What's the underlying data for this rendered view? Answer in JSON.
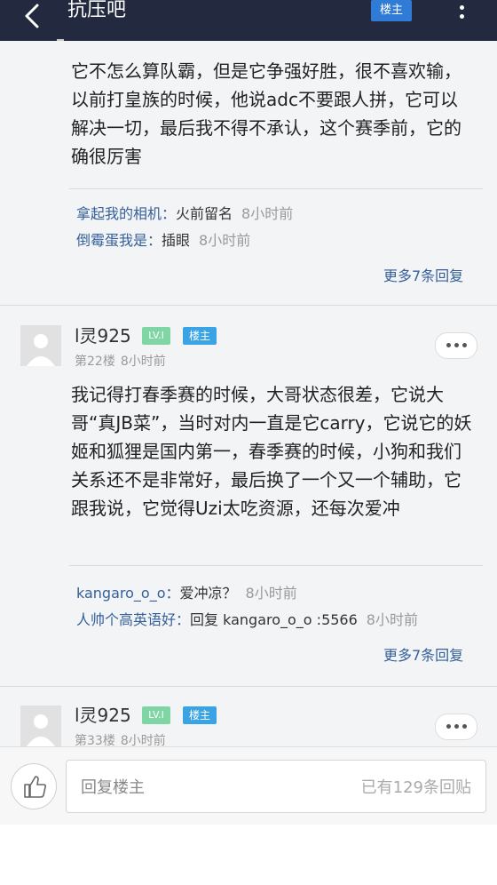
{
  "header": {
    "title": "抗压吧",
    "owner_only_label": "楼主"
  },
  "posts": [
    {
      "content": "它不怎么算队霸，但是它争强好胜，很不喜欢输，以前打皇族的时候，他说adc不要跟人拼，它可以解决一切，最后我不得不承认，这个赛季前，它的确很厉害",
      "replies": [
        {
          "user": "拿起我的相机：",
          "content": "火前留名",
          "time": "8小时前"
        },
        {
          "user": "倒霉蛋我是：",
          "content": "插眼",
          "time": "8小时前"
        }
      ],
      "more_replies": "更多7条回复"
    },
    {
      "username": "l灵925",
      "level_badge": "LV.I",
      "owner_badge": "楼主",
      "floor": "第22楼",
      "time": "8小时前",
      "content": "我记得打春季赛的时候，大哥状态很差，它说大哥“真JB菜”，当时对内一直是它carry，它说它的妖姬和狐狸是国内第一，春季赛的时候，小狗和我们关系还不是非常好，最后换了一个又一个辅助，它跟我说，它觉得Uzi太吃资源，还每次爱冲",
      "replies": [
        {
          "user": "kangaro_o_o：",
          "content": "爱冲凉？",
          "time": "8小时前"
        },
        {
          "user": "人帅个高英语好：",
          "content": "回复 kangaro_o_o :5566",
          "time": "8小时前"
        }
      ],
      "more_replies": "更多7条回复"
    },
    {
      "username": "l灵925",
      "level_badge": "LV.I",
      "owner_badge": "楼主",
      "floor": "第33楼",
      "time": "8小时前"
    }
  ],
  "bottom_bar": {
    "reply_placeholder": "回复楼主",
    "reply_count": "已有129条回贴"
  }
}
